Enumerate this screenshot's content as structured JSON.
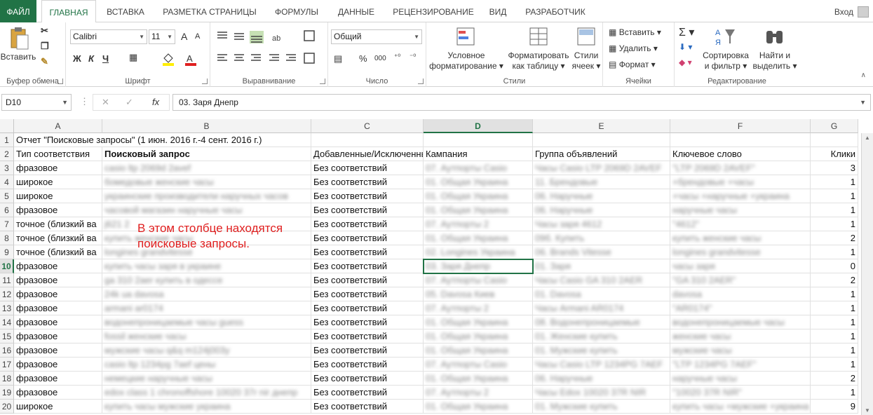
{
  "tabs": {
    "file": "ФАЙЛ",
    "items": [
      "ГЛАВНАЯ",
      "ВСТАВКА",
      "РАЗМЕТКА СТРАНИЦЫ",
      "ФОРМУЛЫ",
      "ДАННЫЕ",
      "РЕЦЕНЗИРОВАНИЕ",
      "ВИД",
      "РАЗРАБОТЧИК"
    ],
    "login": "Вход"
  },
  "ribbon": {
    "clipboard": {
      "paste": "Вставить",
      "label": "Буфер обмена"
    },
    "font": {
      "name": "Calibri",
      "size": "11",
      "bold": "Ж",
      "italic": "К",
      "underline": "Ч",
      "label": "Шрифт",
      "grow": "A",
      "shrink": "A"
    },
    "alignment": {
      "label": "Выравнивание"
    },
    "number": {
      "format": "Общий",
      "percent": "%",
      "thousands": "000",
      "label": "Число"
    },
    "styles": {
      "conditional_1": "Условное",
      "conditional_2": "форматирование",
      "table_1": "Форматировать",
      "table_2": "как таблицу",
      "cell_1": "Стили",
      "cell_2": "ячеек",
      "label": "Стили"
    },
    "cells": {
      "insert": "Вставить",
      "delete": "Удалить",
      "format": "Формат",
      "label": "Ячейки"
    },
    "editing": {
      "sort_1": "Сортировка",
      "sort_2": "и фильтр",
      "find_1": "Найти и",
      "find_2": "выделить",
      "label": "Редактирование"
    }
  },
  "formula_bar": {
    "name_box": "D10",
    "fx": "fx",
    "content": "03. Заря Днепр"
  },
  "grid": {
    "columns": [
      "A",
      "B",
      "C",
      "D",
      "E",
      "F",
      "G"
    ],
    "selected_column": "D",
    "selected_row": "10",
    "rows": [
      {
        "n": "1",
        "a": "Отчет \"Поисковые запросы\" (1 июн. 2016 г.-4 сент. 2016 г.)",
        "b": "",
        "c": "",
        "d": "",
        "e": "",
        "f": "",
        "g": ""
      },
      {
        "n": "2",
        "a": "Тип соответствия",
        "b": "Поисковый запрос",
        "c": "Добавленные/Исключенные",
        "d": "Кампания",
        "e": "Группа объявлений",
        "f": "Ключевое слово",
        "g": "Клики"
      },
      {
        "n": "3",
        "a": "фразовое",
        "b": "casio ltp 2069d 2avef",
        "c": "Без соответствий",
        "d": "07. Аутпорты Casio",
        "e": "Часы Casio LTP 2069D 2AVEF",
        "f": "\"LTP 2069D 2AVEF\"",
        "g": "3"
      },
      {
        "n": "4",
        "a": "широкое",
        "b": "бомедовые женские часы",
        "c": "Без соответствий",
        "d": "01. Общая Украина",
        "e": "11. Брендовые",
        "f": "+брендовые +часы",
        "g": "1"
      },
      {
        "n": "5",
        "a": "широкое",
        "b": "украинские производители наручных часов",
        "c": "Без соответствий",
        "d": "01. Общая Украина",
        "e": "06. Наручные",
        "f": "+часы +наручные +украина",
        "g": "1"
      },
      {
        "n": "6",
        "a": "фразовое",
        "b": "часовой магазин наручные часы",
        "c": "Без соответствий",
        "d": "01. Общая Украина",
        "e": "06. Наручные",
        "f": "наручные часы",
        "g": "1"
      },
      {
        "n": "7",
        "a": "точное (близкий ва",
        "b": "j621 2",
        "c": "Без соответствий",
        "d": "07. Аутпорты 2",
        "e": "Часы заря 4612",
        "f": "\"4612\"",
        "g": "1"
      },
      {
        "n": "8",
        "a": "точное (близкий ва",
        "b": "купить женские часы",
        "c": "Без соответствий",
        "d": "01. Общая Украина",
        "e": "09б. Купить",
        "f": "купить женские часы",
        "g": "2"
      },
      {
        "n": "9",
        "a": "точное (близкий ва",
        "b": "longines grandvitesse",
        "c": "Без соответствий",
        "d": "02. Longines Украина",
        "e": "06. Brands Vitesse",
        "f": "longines grandvitesse",
        "g": "1"
      },
      {
        "n": "10",
        "a": "фразовое",
        "b": "купить часы заря в украине",
        "c": "Без соответствий",
        "d": "03. Заря Днепр",
        "e": "01. Заря",
        "f": "часы заря",
        "g": "0"
      },
      {
        "n": "11",
        "a": "фразовое",
        "b": "ga 310 2aer купить в одессе",
        "c": "Без соответствий",
        "d": "07. Аутпорты Casio",
        "e": "Часы Casio GA 310 2AER",
        "f": "\"GA 310 2AER\"",
        "g": "2"
      },
      {
        "n": "12",
        "a": "фразовое",
        "b": "24k ua davosa",
        "c": "Без соответствий",
        "d": "05. Davosa Киев",
        "e": "01. Davosa",
        "f": "davosa",
        "g": "1"
      },
      {
        "n": "13",
        "a": "фразовое",
        "b": "armani ar0174",
        "c": "Без соответствий",
        "d": "07. Аутпорты 2",
        "e": "Часы Armani AR0174",
        "f": "\"AR0174\"",
        "g": "1"
      },
      {
        "n": "14",
        "a": "фразовое",
        "b": "водонепроницаемые часы guess",
        "c": "Без соответствий",
        "d": "01. Общая Украина",
        "e": "08. Водонепроницаемые",
        "f": "водонепроницаемые часы",
        "g": "1"
      },
      {
        "n": "15",
        "a": "фразовое",
        "b": "fossil женские часы",
        "c": "Без соответствий",
        "d": "01. Общая Украина",
        "e": "01. Женские купить",
        "f": "женские часы",
        "g": "1"
      },
      {
        "n": "16",
        "a": "фразовое",
        "b": "мужские часы q&q m124j003y",
        "c": "Без соответствий",
        "d": "01. Общая Украина",
        "e": "01. Мужские купить",
        "f": "мужские часы",
        "g": "1"
      },
      {
        "n": "17",
        "a": "фразовое",
        "b": "casio ltp 1234pg 7aef цены",
        "c": "Без соответствий",
        "d": "07. Аутпорты Casio",
        "e": "Часы Casio LTP 1234PG 7AEF",
        "f": "\"LTP 1234PG 7AEF\"",
        "g": "1"
      },
      {
        "n": "18",
        "a": "фразовое",
        "b": "немецкие наручные часы",
        "c": "Без соответствий",
        "d": "01. Общая Украина",
        "e": "06. Наручные",
        "f": "наручные часы",
        "g": "2"
      },
      {
        "n": "19",
        "a": "фразовое",
        "b": "edox class 1 chronoffshore 10020 37r nir днепр",
        "c": "Без соответствий",
        "d": "07. Аутпорты 2",
        "e": "Часы Edox 10020 37R NIR",
        "f": "\"10020 37R NIR\"",
        "g": "1"
      },
      {
        "n": "20",
        "a": "широкое",
        "b": "купить часы мужские украина",
        "c": "Без соответствий",
        "d": "01. Общая Украина",
        "e": "01. Мужские купить",
        "f": "купить часы +мужские +украина",
        "g": "9"
      }
    ]
  },
  "annotation": "В этом столбце находятся поисковые запросы.",
  "colors": {
    "accent": "#217346",
    "annotation": "#e02020"
  }
}
